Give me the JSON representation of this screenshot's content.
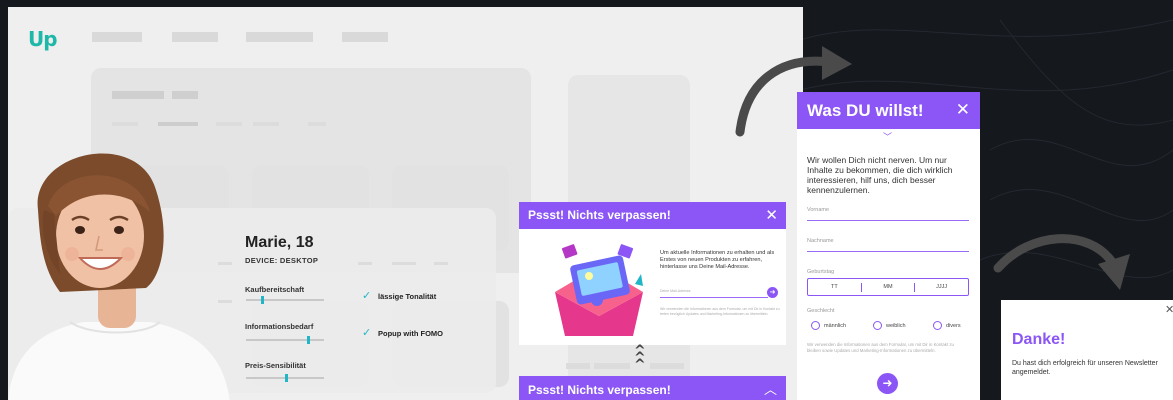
{
  "brand": {
    "logo": "Up",
    "accent": "#8b56f5",
    "teal": "#20b6c8"
  },
  "persona": {
    "name": "Marie, 18",
    "device": "DEVICE: DESKTOP",
    "metrics": [
      {
        "label": "Kaufbereitschaft",
        "level": 0.2
      },
      {
        "label": "Informationsbedarf",
        "level": 0.82
      },
      {
        "label": "Preis-Sensibilität",
        "level": 0.52
      }
    ],
    "checks": [
      "lässige Tonalität",
      "Popup with FOMO"
    ]
  },
  "popup_banner": {
    "title": "Pssst! Nichts verpassen!",
    "close": "✕",
    "text": "Um aktuelle Informationen zu erhalten und als Erstes von neuen Produkten zu erfahren, hinterlasse uns Deine Mail-Adresse.",
    "email_placeholder": "Deine Mail-Adresse",
    "fineprint": "Wir verwenden die Informationen aus dem Formular, um mit Dir in Kontakt zu treten bezüglich Updates und Marketing-Informationen zu übermitteln.",
    "submit_icon": "arrow-right-icon"
  },
  "popup_collapsed": {
    "title": "Pssst! Nichts verpassen!",
    "toggle_icon": "chevron-up-icon"
  },
  "form_popup": {
    "title": "Was DU willst!",
    "close": "✕",
    "intro": "Wir wollen Dich nicht nerven. Um nur Inhalte zu bekommen, die dich wirklich interessieren, hilf uns, dich besser kennenzulernen.",
    "first_name": "Vorname",
    "last_name": "Nachname",
    "birthday_label": "Geburtstag",
    "dob": {
      "day": "TT",
      "month": "MM",
      "year": "JJJJ"
    },
    "gender_label": "Geschlecht",
    "genders": [
      "männlich",
      "weiblich",
      "divers"
    ],
    "fineprint": "Wir verwenden die Informationen aus dem Formular, um mit Dir in Kontakt zu bleiben sowie Updates und Marketing-Informationen zu übermitteln."
  },
  "thanks": {
    "title": "Danke!",
    "message": "Du hast dich erfolgreich für unseren Newsletter angemeldet.",
    "close": "✕"
  }
}
